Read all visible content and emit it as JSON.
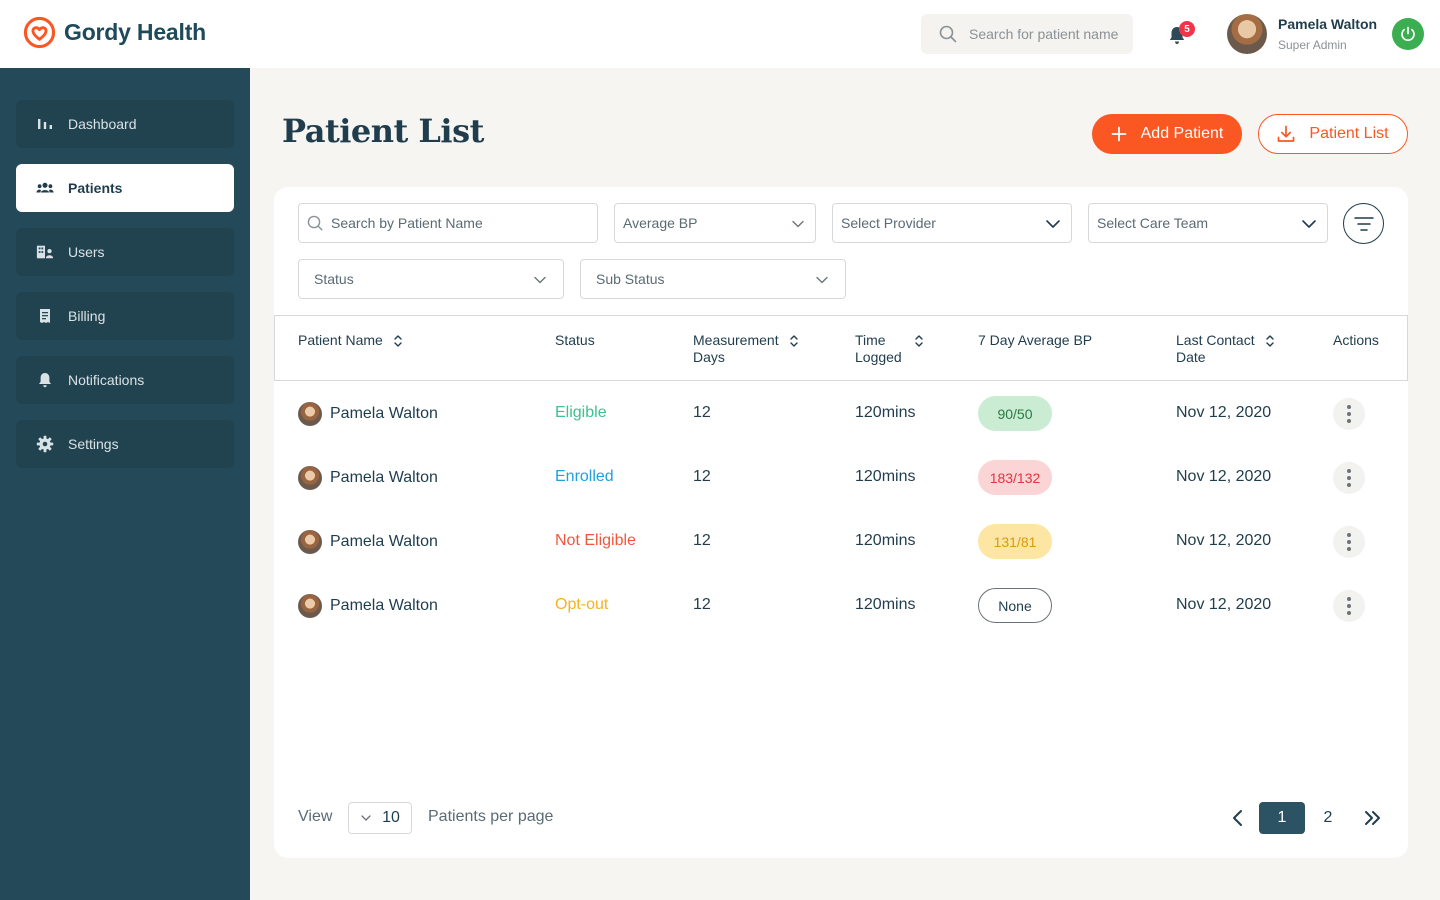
{
  "brand": {
    "name": "Gordy Health",
    "accent": "#fb5722",
    "sidebar_bg": "#244a5a"
  },
  "topbar": {
    "search_placeholder": "Search for patient name",
    "notification_count": "5",
    "user_name": "Pamela Walton",
    "user_role": "Super Admin"
  },
  "sidebar": {
    "items": [
      {
        "label": "Dashboard",
        "icon": "bar-chart-icon",
        "active": false
      },
      {
        "label": "Patients",
        "icon": "people-icon",
        "active": true
      },
      {
        "label": "Users",
        "icon": "users-building-icon",
        "active": false
      },
      {
        "label": "Billing",
        "icon": "receipt-icon",
        "active": false
      },
      {
        "label": "Notifications",
        "icon": "bell-icon",
        "active": false
      },
      {
        "label": "Settings",
        "icon": "gear-icon",
        "active": false
      }
    ]
  },
  "main": {
    "title": "Patient List",
    "add_button": "Add Patient",
    "export_button": "Patient List"
  },
  "filters": {
    "search_placeholder": "Search by Patient Name",
    "average_bp": "Average BP",
    "provider": "Select Provider",
    "care_team": "Select Care Team",
    "status": "Status",
    "sub_status": "Sub Status"
  },
  "table": {
    "headers": {
      "patient_name": "Patient Name",
      "status": "Status",
      "measurement_days_1": "Measurement",
      "measurement_days_2": "Days",
      "time_logged_1": "Time",
      "time_logged_2": "Logged",
      "avg_bp": "7 Day Average BP",
      "last_contact_1": "Last Contact",
      "last_contact_2": "Date",
      "actions": "Actions"
    },
    "rows": [
      {
        "name": "Pamela Walton",
        "status": "Eligible",
        "status_color": "#3ec08f",
        "days": "12",
        "time": "120mins",
        "bp": "90/50",
        "bp_bg": "#c9ecd3",
        "bp_color": "#2b7a44",
        "last_contact": "Nov 12, 2020"
      },
      {
        "name": "Pamela Walton",
        "status": "Enrolled",
        "status_color": "#1fa0e0",
        "days": "12",
        "time": "120mins",
        "bp": "183/132",
        "bp_bg": "#fbd4d6",
        "bp_color": "#e2353f",
        "last_contact": "Nov 12, 2020"
      },
      {
        "name": "Pamela Walton",
        "status": "Not Eligible",
        "status_color": "#f2573c",
        "days": "12",
        "time": "120mins",
        "bp": "131/81",
        "bp_bg": "#fde6a3",
        "bp_color": "#d99a10",
        "last_contact": "Nov 12, 2020"
      },
      {
        "name": "Pamela Walton",
        "status": "Opt-out",
        "status_color": "#f5b321",
        "days": "12",
        "time": "120mins",
        "bp": "None",
        "bp_bg": "#ffffff",
        "bp_color": "#1f3d4c",
        "last_contact": "Nov 12, 2020"
      }
    ]
  },
  "pagination": {
    "view_label": "View",
    "per_page_value": "10",
    "per_page_label": "Patients per page",
    "current_page": "1",
    "next_page": "2"
  }
}
